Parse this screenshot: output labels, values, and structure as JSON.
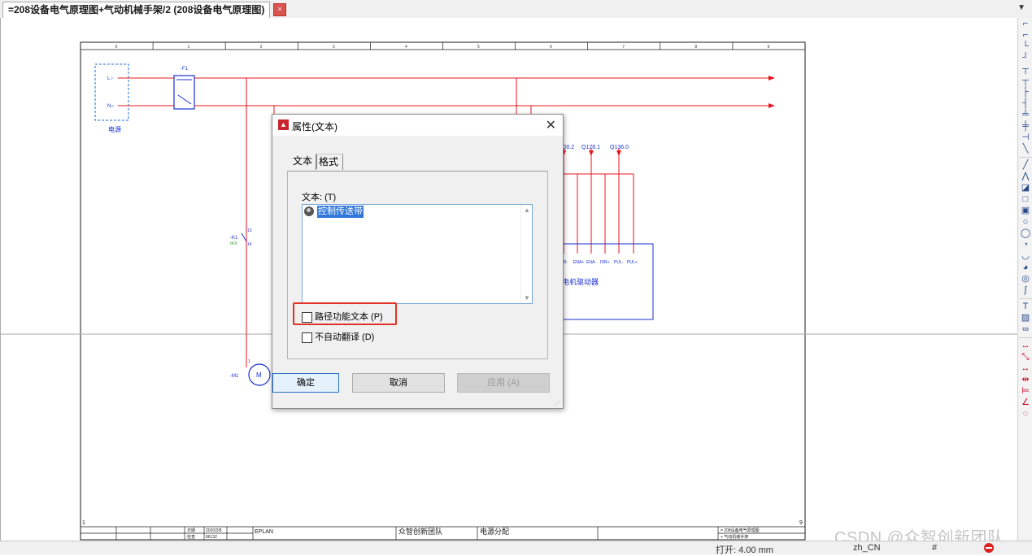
{
  "document_tab": {
    "title": "=208设备电气原理图+气动机械手架/2 (208设备电气原理图)",
    "close_symbol": "×",
    "dropdown_symbol": "▼"
  },
  "schematic": {
    "column_numbers": [
      "0",
      "1",
      "2",
      "3",
      "4",
      "5",
      "6",
      "7",
      "8",
      "9"
    ],
    "page_start": "1",
    "page_end": "9",
    "power_supply_label": "电源",
    "terminal_l": "L○",
    "terminal_n": "N○",
    "breaker_tag": "-F1",
    "switch_tag": "-K1",
    "switch_ref": "/4.0",
    "switch_pin_top": "13",
    "switch_pin_bottom": "14",
    "motor_tag": "-M1",
    "motor_symbol": "M",
    "motor_pin": "1",
    "signal_refs": [
      "Q0.2",
      "Q128.1",
      "Q136.0"
    ],
    "drive_pins": [
      "DIR-",
      "ENA+",
      "ENA-",
      "DIR+",
      "PUL-",
      "PUL+"
    ],
    "drive_label": "电机驱动器",
    "title_block": {
      "created_label": "日期",
      "created_date": "2020/2/8",
      "editor_label": "检查",
      "editor_value": "86132",
      "software": "EPLAN",
      "team": "众智创新团队",
      "page_name": "电源分配",
      "ref1": "= 208设备电气原理图",
      "ref2": "+ 气动机械手架"
    }
  },
  "dialog": {
    "title": "属性(文本)",
    "close_symbol": "✕",
    "tabs": [
      {
        "label": "文本"
      },
      {
        "label": "格式"
      }
    ],
    "text_label": "文本: (T)",
    "text_value": "控制传送带",
    "checkbox_path_function": "路径功能文本 (P)",
    "checkbox_no_translate": "不自动翻译 (D)",
    "buttons": {
      "ok": "确定",
      "cancel": "取消",
      "apply": "应用 (A)"
    },
    "highlight_color": "#e03226"
  },
  "status_bar": {
    "snap": "打开: 4.00 mm",
    "language": "zh_CN",
    "hash": "#"
  },
  "watermark": "CSDN @众智创新团队",
  "colors": {
    "wire_red": "#e8141e",
    "symbol_blue": "#1a2fd6",
    "frame_black": "#1a1a1a"
  }
}
